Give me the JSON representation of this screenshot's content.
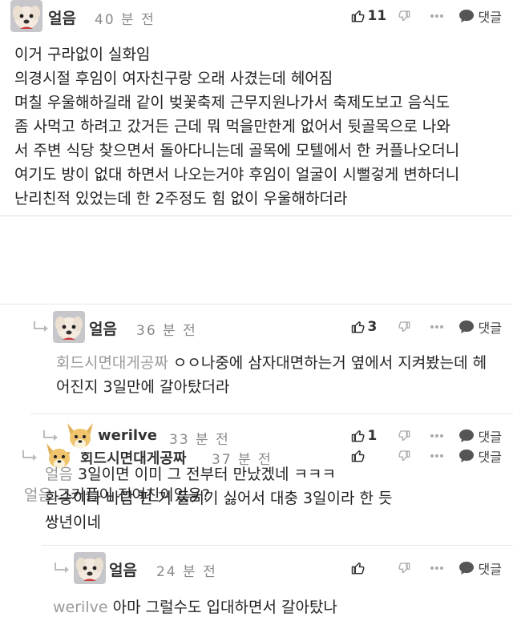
{
  "comments": [
    {
      "author": "얼음",
      "time": "40 분 전",
      "likes": "11",
      "reply_label": "댓글",
      "text": "이거 구라없이 실화임\n의경시절 후임이 여자친구랑 오래 사겼는데 헤어짐\n며칠 우울해하길래 같이 벚꽃축제 근무지원나가서 축제도보고 음식도\n좀 사먹고 하려고 갔거든 근데 뭐 먹을만한게 없어서 뒷골목으로 나와\n서 주변 식당 찾으면서 돌아다니는데 골목에 모텔에서 한 커플나오더니\n여기도 방이 없대 하면서 나오는거야 후임이 얼굴이 시뻘겋게 변하더니\n난리친적 있었는데 한 2주정도 힘 없이 우울해하더라"
    },
    {
      "author": "회드시면대게공짜",
      "time": "37 분 전",
      "likes": "",
      "reply_label": "댓글",
      "mention": "얼음",
      "text": "그커플이 전여친이었음?"
    },
    {
      "author": "얼음",
      "time": "36 분 전",
      "likes": "3",
      "reply_label": "댓글",
      "mention": "회드시면대게공짜",
      "text": "ㅇㅇ나중에 삼자대면하는거 옆에서 지켜봤는데 헤\n어진지 3일만에 갈아탔더라"
    },
    {
      "author": "werilve",
      "time": "33 분 전",
      "likes": "1",
      "reply_label": "댓글",
      "mention": "얼음",
      "text": "3일이면 이미 그 전부터 만났겠네 ㅋㅋㅋ\n환승이나 바람 핀 거 들키기 싫어서 대충 3일이라 한 듯\n쌍년이네"
    },
    {
      "author": "얼음",
      "time": "24 분 전",
      "likes": "",
      "reply_label": "댓글",
      "mention": "werilve",
      "text": "아마 그럴수도 입대하면서 갈아탔나"
    }
  ],
  "icons": {
    "like": "thumbs-up-icon",
    "dislike": "thumbs-down-icon",
    "more": "more-dots-icon",
    "reply": "speech-bubble-icon",
    "nested": "reply-arrow-icon"
  },
  "colors": {
    "mention": "#9a9a9a",
    "text": "#222222",
    "meta": "#8a8a8a"
  }
}
